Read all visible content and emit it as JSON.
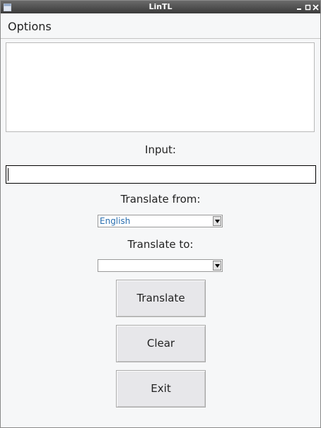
{
  "window": {
    "title": "LinTL"
  },
  "menubar": {
    "options_label": "Options"
  },
  "output": {
    "text": ""
  },
  "input": {
    "label": "Input:",
    "value": ""
  },
  "translate_from": {
    "label": "Translate from:",
    "selected": "English"
  },
  "translate_to": {
    "label": "Translate to:",
    "selected": ""
  },
  "buttons": {
    "translate": "Translate",
    "clear": "Clear",
    "exit": "Exit"
  },
  "colors": {
    "titlebar": "#3a3a3a",
    "selected_text": "#2a6fb0",
    "button_bg": "#e7e7ea"
  },
  "icons": {
    "app": "window-icon",
    "minimize": "minimize-icon",
    "maximize": "maximize-icon",
    "close": "close-icon",
    "dropdown": "chevron-down-icon"
  }
}
